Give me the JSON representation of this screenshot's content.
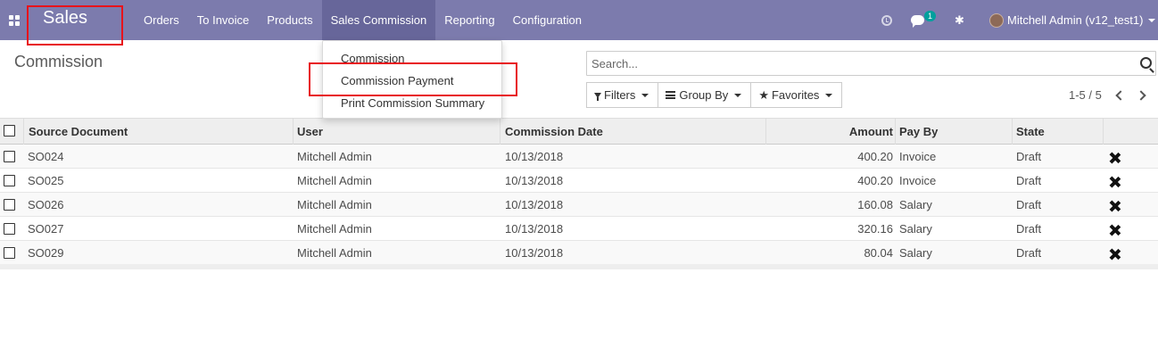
{
  "navbar": {
    "brand": "Sales",
    "menu": [
      "Orders",
      "To Invoice",
      "Products",
      "Sales Commission",
      "Reporting",
      "Configuration"
    ],
    "active_menu": "Sales Commission",
    "chat_count": "1",
    "user_label": "Mitchell Admin (v12_test1)"
  },
  "breadcrumb": "Commission",
  "search": {
    "placeholder": "Search..."
  },
  "filters": {
    "filters_label": "Filters",
    "group_by_label": "Group By",
    "favorites_label": "Favorites"
  },
  "pager": {
    "text": "1-5 / 5"
  },
  "dropdown": {
    "items": [
      "Commission",
      "Commission Payment",
      "Print Commission Summary"
    ],
    "highlighted": "Commission Payment"
  },
  "table": {
    "columns": [
      "Source Document",
      "User",
      "Commission Date",
      "Amount",
      "Pay By",
      "State"
    ],
    "rows": [
      [
        "SO024",
        "Mitchell Admin",
        "10/13/2018",
        "400.20",
        "Invoice",
        "Draft"
      ],
      [
        "SO025",
        "Mitchell Admin",
        "10/13/2018",
        "400.20",
        "Invoice",
        "Draft"
      ],
      [
        "SO026",
        "Mitchell Admin",
        "10/13/2018",
        "160.08",
        "Salary",
        "Draft"
      ],
      [
        "SO027",
        "Mitchell Admin",
        "10/13/2018",
        "320.16",
        "Salary",
        "Draft"
      ],
      [
        "SO029",
        "Mitchell Admin",
        "10/13/2018",
        "80.04",
        "Salary",
        "Draft"
      ]
    ]
  },
  "colors": {
    "navbar": "#7c7bad",
    "navbar_active": "#67669a",
    "highlight_box": "#e8131b",
    "badge": "#00a09d"
  },
  "icons": [
    "apps-icon",
    "clock-icon",
    "chat-icon",
    "bug-icon",
    "search-icon",
    "filter-icon",
    "group-by-icon",
    "star-icon",
    "delete-icon"
  ]
}
